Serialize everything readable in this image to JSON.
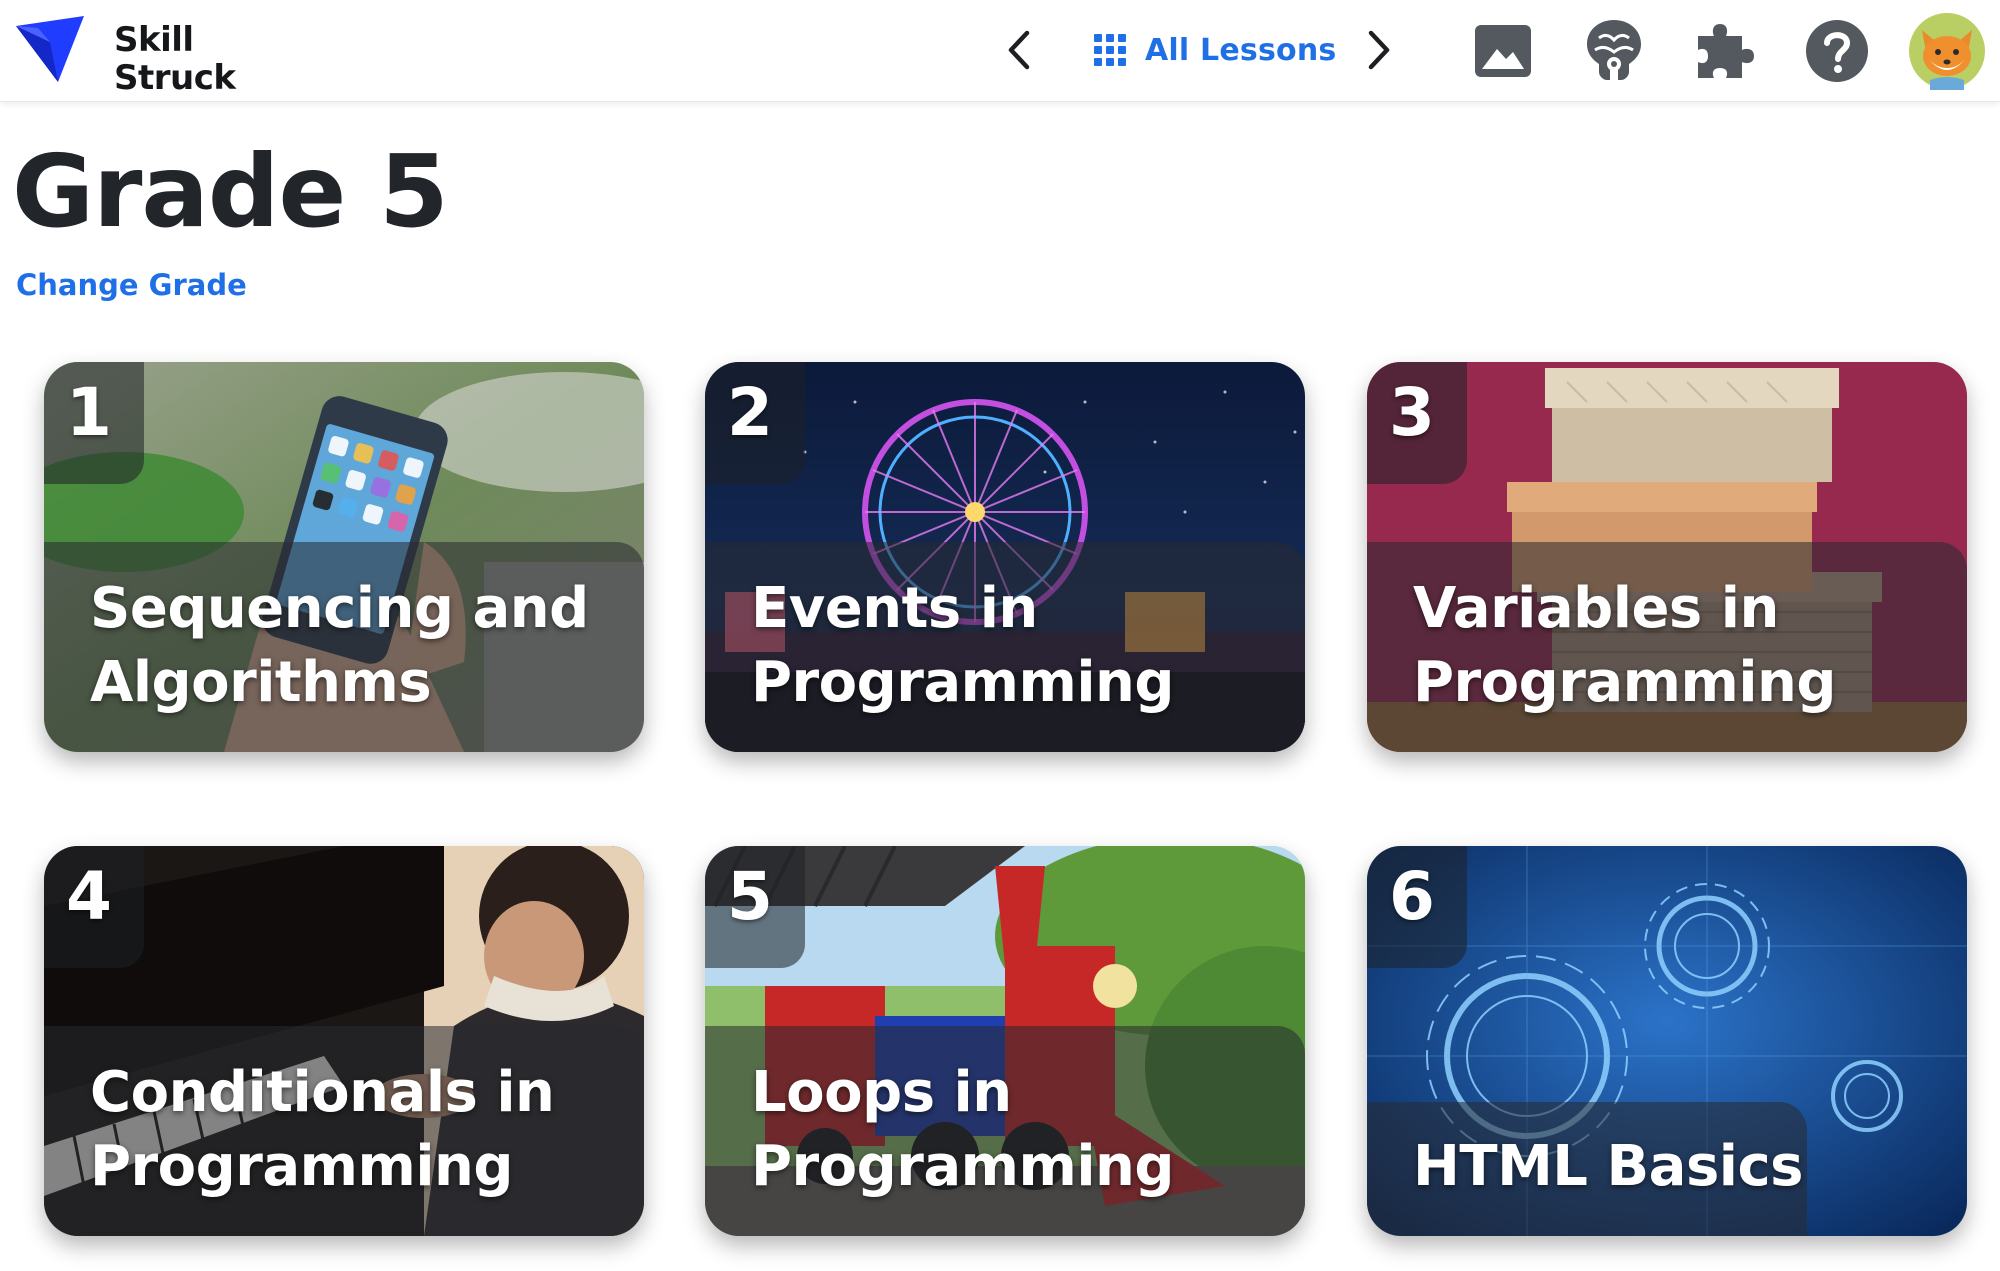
{
  "brand": {
    "name_line1": "Skill",
    "name_line2": "Struck",
    "logo_color": "#1f3cff"
  },
  "header": {
    "prev_icon": "chevron-left-icon",
    "next_icon": "chevron-right-icon",
    "all_lessons_label": "All Lessons",
    "all_lessons_icon": "grid-icon",
    "icons": [
      "gallery-icon",
      "brain-icon",
      "puzzle-icon",
      "help-icon",
      "fox-avatar-icon"
    ],
    "accent": "#1f6fe6"
  },
  "page": {
    "title": "Grade 5",
    "change_grade_label": "Change Grade"
  },
  "lessons": [
    {
      "number": "1",
      "title": "Sequencing and Algorithms"
    },
    {
      "number": "2",
      "title": "Events in Programming"
    },
    {
      "number": "3",
      "title": "Variables in Programming"
    },
    {
      "number": "4",
      "title": "Conditionals in Programming"
    },
    {
      "number": "5",
      "title": "Loops in Programming"
    },
    {
      "number": "6",
      "title": "HTML Basics"
    }
  ]
}
